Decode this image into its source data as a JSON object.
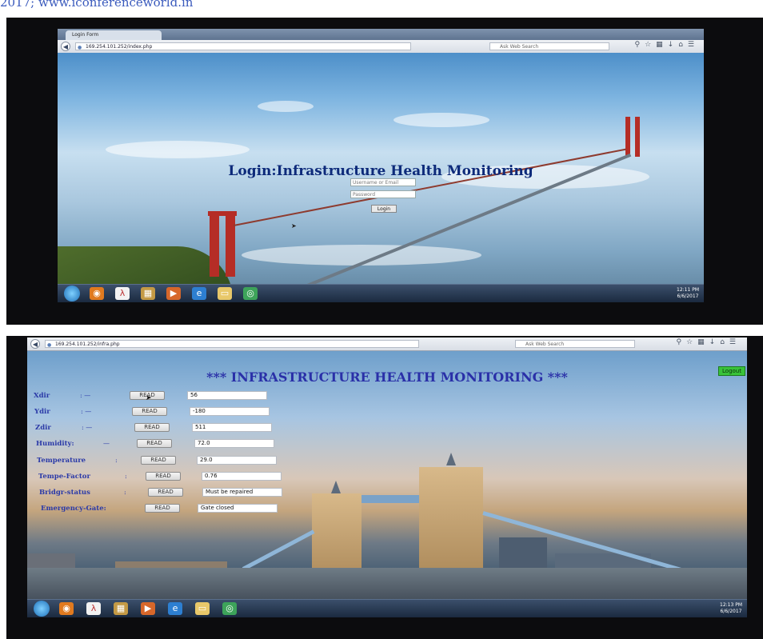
{
  "caption": "2017; www.iconferenceworld.in",
  "screen1": {
    "tab_title": "Login Form",
    "url": "169.254.101.252/index.php",
    "search_placeholder": "Ask Web Search",
    "heading": "Login:Infrastructure Health Monitoring",
    "username_placeholder": "Username or Email",
    "password_placeholder": "Password",
    "login_label": "Login",
    "clock_time": "12:11 PM",
    "clock_date": "6/6/2017"
  },
  "screen2": {
    "url": "169.254.101.252/infra.php",
    "search_placeholder": "Ask Web Search",
    "heading": "*** INFRASTRUCTURE HEALTH MONITORING ***",
    "logout_label": "Logout",
    "read_label": "READ",
    "rows": [
      {
        "label": "Xdir",
        "sep": ":   —",
        "value": "56"
      },
      {
        "label": "Ydir",
        "sep": ":   —",
        "value": "-180"
      },
      {
        "label": "Zdir",
        "sep": ":   —",
        "value": "511"
      },
      {
        "label": "Humidity:",
        "sep": "—",
        "value": "72.0"
      },
      {
        "label": "Temperature",
        "sep": ":",
        "value": "29.0"
      },
      {
        "label": "Tempe-Factor",
        "sep": ":",
        "value": "0.76"
      },
      {
        "label": "Bridgr-status",
        "sep": ":",
        "value": "Must be repaired"
      },
      {
        "label": "Emergency-Gate:",
        "sep": "",
        "value": "Gate closed"
      }
    ],
    "clock_time": "12:13 PM",
    "clock_date": "6/6/2017"
  },
  "taskbar_icons": [
    "windows-start-icon",
    "firefox-icon",
    "pdf-reader-icon",
    "media-center-icon",
    "media-player-icon",
    "internet-explorer-icon",
    "folder-icon",
    "chrome-icon"
  ]
}
